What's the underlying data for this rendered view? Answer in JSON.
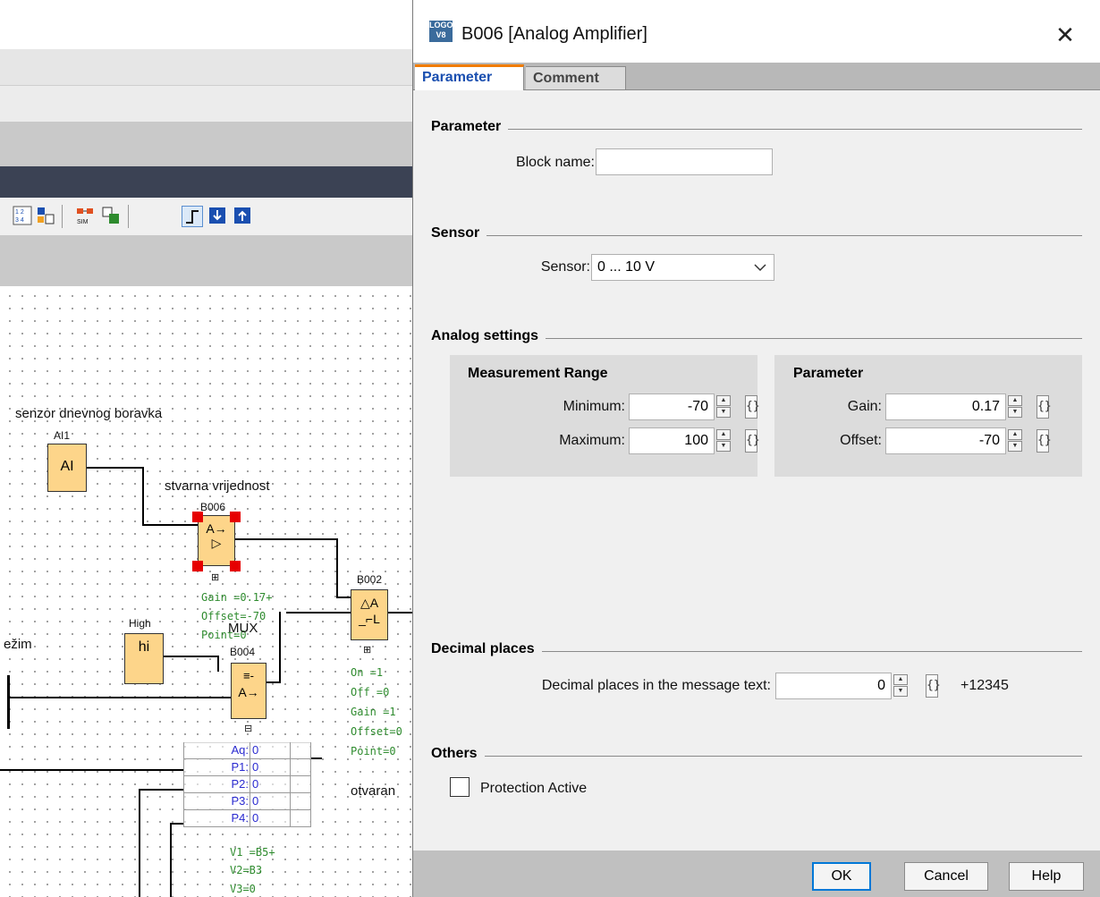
{
  "background": {
    "canvas_labels": {
      "sensor_title": "senzor dnevnog boravka",
      "ai1": "AI1",
      "ai_block": "AI",
      "stvarna": "stvarna vrijednost",
      "b006": "B006",
      "b002": "B002",
      "high": "High",
      "hi_block": "hi",
      "mux": "MUX",
      "b004": "B004",
      "rezim": "ežim",
      "gain": "Gain =0.17+",
      "offset": "Offset=-70",
      "point": "Point=0",
      "on": "On  =1",
      "off": "Off  =0",
      "gain2": "Gain =1",
      "offset2": "Offset=0",
      "point2": "Point=0",
      "otvaran": "otvaran",
      "v1": "V1 =B5+",
      "v2": "V2=B3",
      "v3": "V3=0"
    },
    "param_table": [
      {
        "label": "Aq:",
        "value": "0"
      },
      {
        "label": "P1:",
        "value": "0"
      },
      {
        "label": "P2:",
        "value": "0"
      },
      {
        "label": "P3:",
        "value": "0"
      },
      {
        "label": "P4:",
        "value": "0"
      }
    ]
  },
  "dialog": {
    "icon_text": "LOGO V8",
    "title": "B006 [Analog Amplifier]",
    "close_symbol": "✕",
    "tabs": [
      "Parameter",
      "Comment"
    ],
    "sections": {
      "parameter": "Parameter",
      "sensor": "Sensor",
      "analog": "Analog settings",
      "decimal": "Decimal places",
      "others": "Others"
    },
    "block_name_label": "Block name:",
    "block_name_value": "",
    "sensor_label": "Sensor:",
    "sensor_value": "0 ... 10 V",
    "measurement_range": {
      "title": "Measurement Range",
      "min_label": "Minimum:",
      "min_value": "-70",
      "max_label": "Maximum:",
      "max_value": "100"
    },
    "parameter_panel": {
      "title": "Parameter",
      "gain_label": "Gain:",
      "gain_value": "0.17",
      "offset_label": "Offset:",
      "offset_value": "-70"
    },
    "decimal_label": "Decimal places in the message text:",
    "decimal_value": "0",
    "decimal_example": "+12345",
    "protection_label": "Protection Active",
    "protection_checked": false,
    "buttons": {
      "ok": "OK",
      "cancel": "Cancel",
      "help": "Help"
    }
  }
}
